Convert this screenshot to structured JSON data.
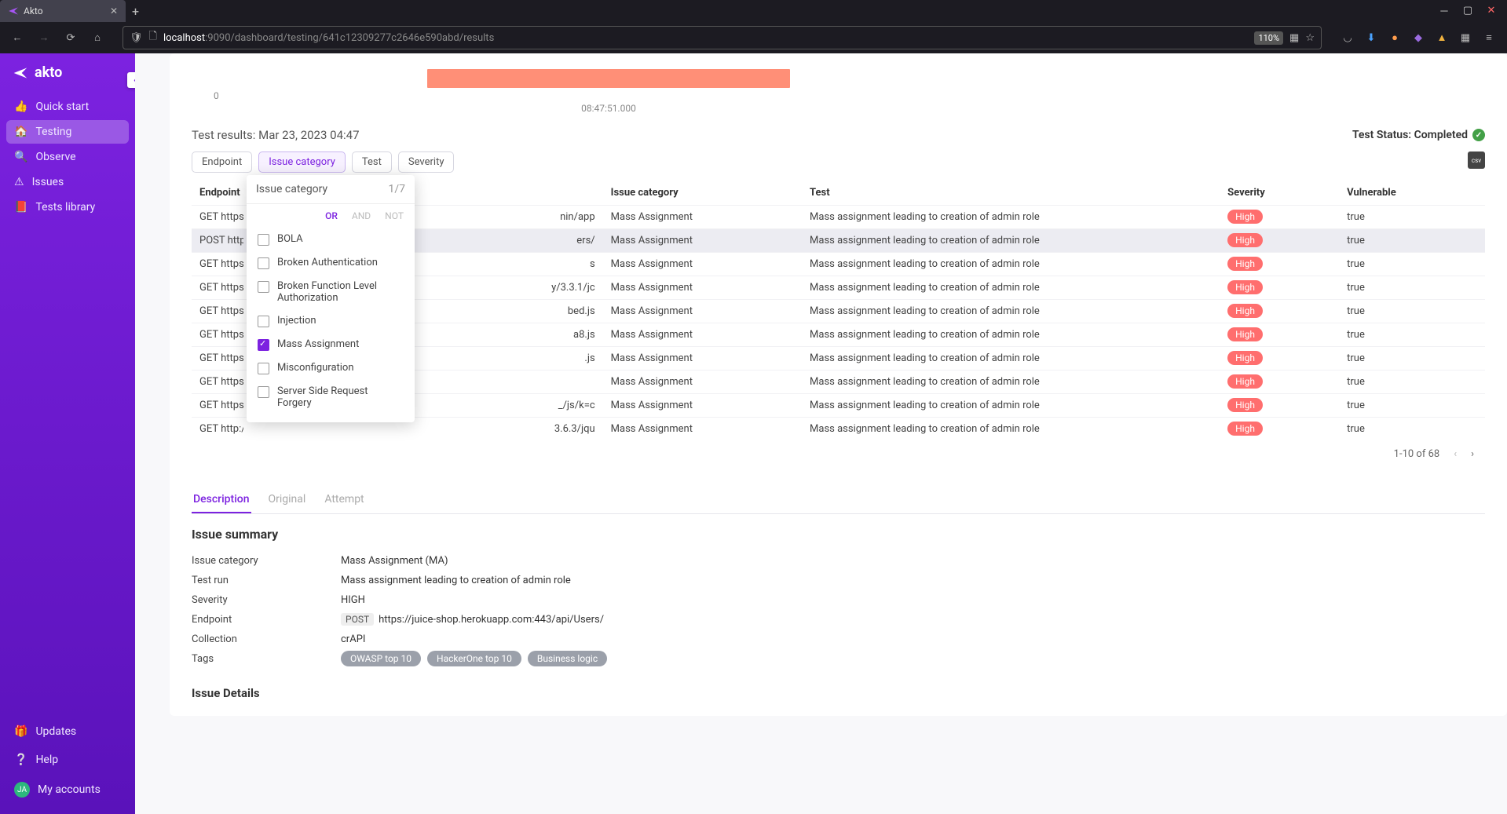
{
  "browser": {
    "tab_title": "Akto",
    "url_host": "localhost",
    "url_port": ":9090",
    "url_path": "/dashboard/testing/641c12309277c2646e590abd/results",
    "zoom": "110%"
  },
  "sidebar": {
    "brand": "akto",
    "items": [
      {
        "label": "Quick start",
        "icon": "thumb"
      },
      {
        "label": "Testing",
        "icon": "home",
        "active": true
      },
      {
        "label": "Observe",
        "icon": "search"
      },
      {
        "label": "Issues",
        "icon": "warn"
      },
      {
        "label": "Tests library",
        "icon": "book"
      }
    ],
    "bottom": [
      {
        "label": "Updates",
        "icon": "gift"
      },
      {
        "label": "Help",
        "icon": "help"
      },
      {
        "label": "My accounts",
        "icon": "avatar",
        "initials": "JA"
      }
    ]
  },
  "chart_data": {
    "type": "bar",
    "title": "",
    "xlabel": "",
    "ylabel": "",
    "categories": [
      "08:47:51.000"
    ],
    "values": [
      1
    ],
    "ylim": [
      0,
      1
    ],
    "y_tick": "0",
    "x_tick": "08:47:51.000"
  },
  "results": {
    "header_left": "Test results: Mar 23, 2023 04:47",
    "status_label": "Test Status: Completed",
    "filters": [
      {
        "label": "Endpoint"
      },
      {
        "label": "Issue category",
        "active": true
      },
      {
        "label": "Test"
      },
      {
        "label": "Severity"
      }
    ],
    "columns": [
      "Endpoint",
      "Issue category",
      "Test",
      "Severity",
      "Vulnerable"
    ],
    "rows": [
      {
        "endpoint": "GET https:/",
        "endpoint_suffix": "nin/app",
        "issue": "Mass Assignment",
        "test": "Mass assignment leading to creation of admin role",
        "sev": "High",
        "vuln": "true"
      },
      {
        "endpoint": "POST https:",
        "endpoint_suffix": "ers/",
        "issue": "Mass Assignment",
        "test": "Mass assignment leading to creation of admin role",
        "sev": "High",
        "vuln": "true",
        "hover": true
      },
      {
        "endpoint": "GET https:/",
        "endpoint_suffix": "s",
        "issue": "Mass Assignment",
        "test": "Mass assignment leading to creation of admin role",
        "sev": "High",
        "vuln": "true"
      },
      {
        "endpoint": "GET https:/",
        "endpoint_suffix": "y/3.3.1/jc",
        "issue": "Mass Assignment",
        "test": "Mass assignment leading to creation of admin role",
        "sev": "High",
        "vuln": "true"
      },
      {
        "endpoint": "GET https:/",
        "endpoint_suffix": "bed.js",
        "issue": "Mass Assignment",
        "test": "Mass assignment leading to creation of admin role",
        "sev": "High",
        "vuln": "true"
      },
      {
        "endpoint": "GET https:/",
        "endpoint_suffix": "a8.js",
        "issue": "Mass Assignment",
        "test": "Mass assignment leading to creation of admin role",
        "sev": "High",
        "vuln": "true"
      },
      {
        "endpoint": "GET https:/",
        "endpoint_suffix": ".js",
        "issue": "Mass Assignment",
        "test": "Mass assignment leading to creation of admin role",
        "sev": "High",
        "vuln": "true"
      },
      {
        "endpoint": "GET https:/",
        "endpoint_suffix": "",
        "issue": "Mass Assignment",
        "test": "Mass assignment leading to creation of admin role",
        "sev": "High",
        "vuln": "true"
      },
      {
        "endpoint": "GET https:/",
        "endpoint_suffix": "_/js/k=c",
        "issue": "Mass Assignment",
        "test": "Mass assignment leading to creation of admin role",
        "sev": "High",
        "vuln": "true"
      },
      {
        "endpoint": "GET http://",
        "endpoint_suffix": "3.6.3/jqu",
        "issue": "Mass Assignment",
        "test": "Mass assignment leading to creation of admin role",
        "sev": "High",
        "vuln": "true"
      }
    ],
    "pagination": {
      "range": "1-10 of 68"
    }
  },
  "dropdown": {
    "title": "Issue category",
    "count": "1/7",
    "logic": [
      "OR",
      "AND",
      "NOT"
    ],
    "logic_active": "OR",
    "items": [
      {
        "label": "BOLA",
        "checked": false
      },
      {
        "label": "Broken Authentication",
        "checked": false
      },
      {
        "label": "Broken Function Level Authorization",
        "checked": false
      },
      {
        "label": "Injection",
        "checked": false
      },
      {
        "label": "Mass Assignment",
        "checked": true
      },
      {
        "label": "Misconfiguration",
        "checked": false
      },
      {
        "label": "Server Side Request Forgery",
        "checked": false
      }
    ]
  },
  "detail": {
    "tabs": [
      "Description",
      "Original",
      "Attempt"
    ],
    "active_tab": "Description",
    "summary_heading": "Issue summary",
    "rows": [
      {
        "k": "Issue category",
        "v": "Mass Assignment (MA)"
      },
      {
        "k": "Test run",
        "v": "Mass assignment leading to creation of admin role"
      },
      {
        "k": "Severity",
        "v": "HIGH"
      },
      {
        "k": "Endpoint",
        "method": "POST",
        "v": "https://juice-shop.herokuapp.com:443/api/Users/"
      },
      {
        "k": "Collection",
        "v": "crAPI"
      },
      {
        "k": "Tags",
        "tags": [
          "OWASP top 10",
          "HackerOne top 10",
          "Business logic"
        ]
      }
    ],
    "issue_details_heading": "Issue Details"
  },
  "export_label": "csv"
}
